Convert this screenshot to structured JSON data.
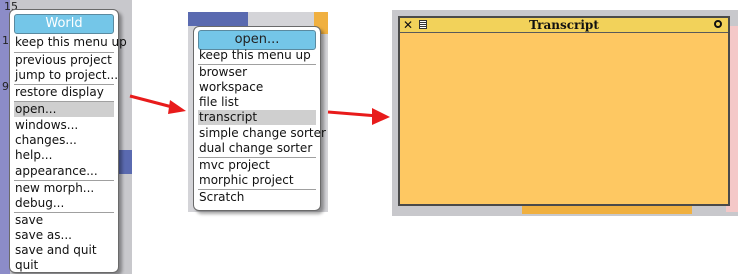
{
  "world_menu": {
    "title": "World",
    "items": [
      {
        "label": "keep this menu up"
      },
      {
        "label": "previous project"
      },
      {
        "label": "jump to project..."
      },
      {
        "label": "restore display"
      },
      {
        "label": "open...",
        "selected": true
      },
      {
        "label": "windows..."
      },
      {
        "label": "changes..."
      },
      {
        "label": "help..."
      },
      {
        "label": "appearance..."
      },
      {
        "label": "new morph..."
      },
      {
        "label": "debug..."
      },
      {
        "label": "save"
      },
      {
        "label": "save as..."
      },
      {
        "label": "save and quit"
      },
      {
        "label": "quit"
      }
    ],
    "bg_number": "15",
    "bg_number2": "1",
    "bg_number3": "9"
  },
  "open_menu": {
    "title": "open...",
    "items": [
      {
        "label": "keep this menu up"
      },
      {
        "label": "browser"
      },
      {
        "label": "workspace"
      },
      {
        "label": "file list"
      },
      {
        "label": "transcript",
        "selected": true
      },
      {
        "label": "simple change sorter"
      },
      {
        "label": "dual change sorter"
      },
      {
        "label": "mvc project"
      },
      {
        "label": "morphic project"
      },
      {
        "label": "Scratch"
      }
    ]
  },
  "transcript_window": {
    "title": "Transcript",
    "bg_color": "#fec862",
    "close_icon": "close-icon",
    "menu_icon": "window-menu-icon",
    "collapse_icon": "collapse-icon"
  },
  "colors": {
    "menu_title": "#74c6e8",
    "arrow": "#e81b1b",
    "selection": "#cfcfcf"
  }
}
